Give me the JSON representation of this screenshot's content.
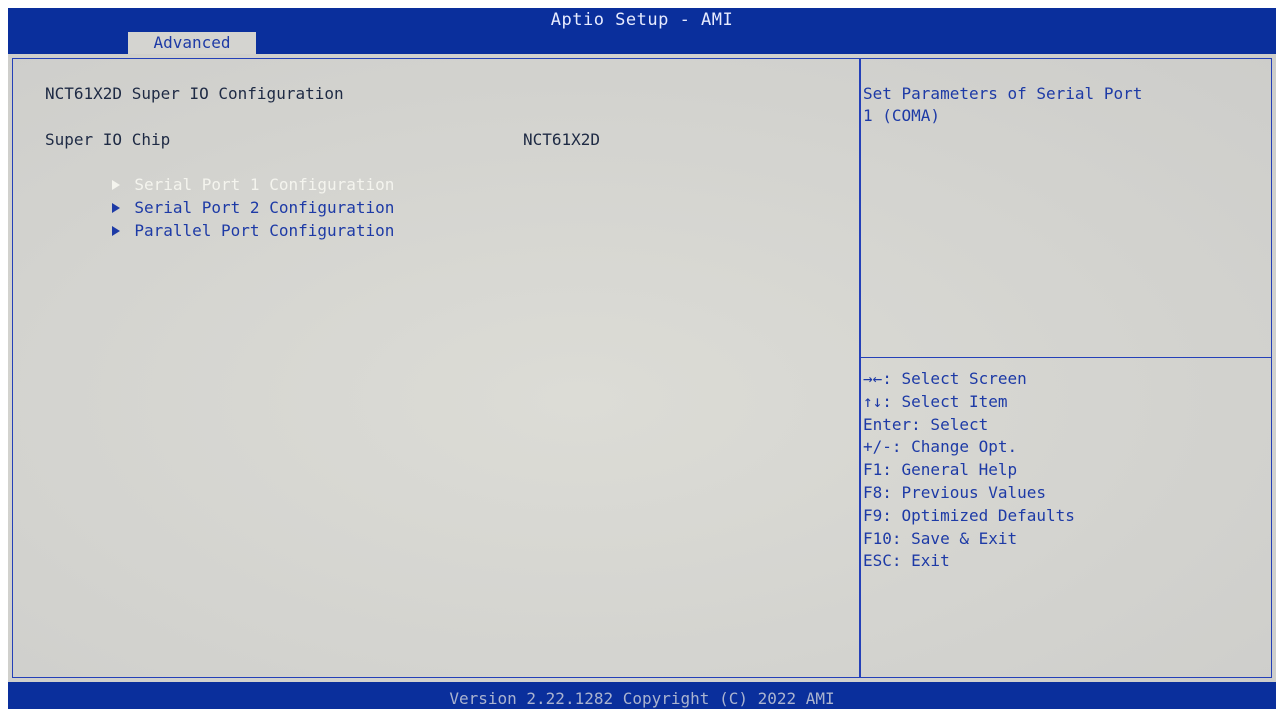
{
  "header": {
    "title": "Aptio Setup - AMI",
    "active_tab": "Advanced"
  },
  "main": {
    "section_title": "NCT61X2D Super IO Configuration",
    "chip_label": "Super IO Chip",
    "chip_value": "NCT61X2D",
    "menu_items": [
      {
        "label": "Serial Port 1 Configuration",
        "selected": true
      },
      {
        "label": "Serial Port 2 Configuration",
        "selected": false
      },
      {
        "label": "Parallel Port Configuration",
        "selected": false
      }
    ]
  },
  "help": {
    "description_line1": "Set Parameters of Serial Port",
    "description_line2": "1 (COMA)",
    "keys": [
      "→←: Select Screen",
      "↑↓: Select Item",
      "Enter: Select",
      "+/-: Change Opt.",
      "F1: General Help",
      "F8: Previous Values",
      "F9: Optimized Defaults",
      "F10: Save & Exit",
      "ESC: Exit"
    ]
  },
  "footer": {
    "text": "Version 2.22.1282 Copyright (C) 2022 AMI"
  },
  "colors": {
    "frame_blue": "#0a2f9c",
    "panel_gray": "#d4d4d0",
    "text_blue": "#1d3aa6",
    "highlight_white": "#f4f4ee"
  }
}
